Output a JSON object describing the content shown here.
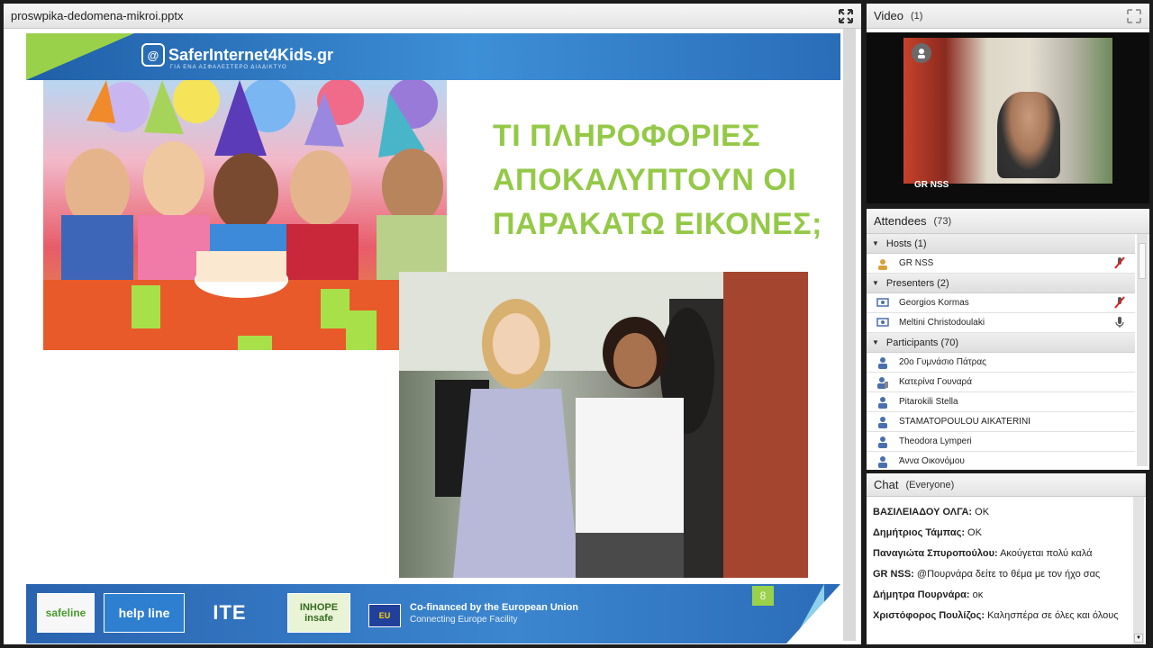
{
  "share": {
    "title": "proswpika-dedomena-mikroi.pptx",
    "slide": {
      "logo_text": "SaferInternet4Kids.gr",
      "logo_tagline": "ΓΙΑ ΕΝΑ ΑΣΦΑΛΕΣΤΕΡΟ ΔΙΑΔΙΚΤΥΟ",
      "title_lines": [
        "ΤΙ ΠΛΗΡΟΦΟΡΙΕΣ",
        "ΑΠΟΚΑΛΥΠΤΟΥΝ ΟΙ",
        "ΠΑΡΑΚΑΤΩ ΕΙΚΟΝΕΣ;"
      ],
      "slide_number": "8",
      "partners": {
        "safeline": "safeline",
        "helpline": "help line",
        "ite": "ITE",
        "inhope": "INHOPE insafe",
        "eu": "EU"
      },
      "cofinanced_line1": "Co-financed by the European Union",
      "cofinanced_line2": "Connecting Europe Facility"
    }
  },
  "video": {
    "title": "Video",
    "count": "(1)",
    "presenter_label": "GR NSS"
  },
  "attendees": {
    "title": "Attendees",
    "count": "(73)",
    "groups": [
      {
        "label": "Hosts (1)",
        "people": [
          {
            "name": "GR NSS",
            "role": "host",
            "mic": "muted"
          }
        ]
      },
      {
        "label": "Presenters (2)",
        "people": [
          {
            "name": "Georgios Kormas",
            "role": "presenter",
            "mic": "muted"
          },
          {
            "name": "Meltini Christodoulaki",
            "role": "presenter",
            "mic": "on"
          }
        ]
      },
      {
        "label": "Participants (70)",
        "people": [
          {
            "name": "20ο Γυμνάσιο Πάτρας",
            "role": "participant",
            "mic": ""
          },
          {
            "name": "Κατερίνα Γουναρά",
            "role": "participant-phone",
            "mic": ""
          },
          {
            "name": "Pitarokili Stella",
            "role": "participant",
            "mic": ""
          },
          {
            "name": "STAMATOPOULOU AIKATERINI",
            "role": "participant",
            "mic": ""
          },
          {
            "name": "Theodora Lymperi",
            "role": "participant",
            "mic": ""
          },
          {
            "name": "Άννα Οικονόμου",
            "role": "participant",
            "mic": ""
          }
        ]
      }
    ]
  },
  "chat": {
    "title": "Chat",
    "scope": "(Everyone)",
    "messages": [
      {
        "sender": "ΒΑΣΙΛΕΙΑΔΟΥ ΟΛΓΑ:",
        "text": " OK"
      },
      {
        "sender": "Δημήτριος Τάμπας:",
        "text": " OK"
      },
      {
        "sender": "Παναγιώτα Σπυροπούλου:",
        "text": " Ακούγεται πολύ καλά"
      },
      {
        "sender": "GR NSS:",
        "text": " @Πουρνάρα δείτε το θέμα με τον ήχο σας"
      },
      {
        "sender": "Δήμητρα Πουρνάρα:",
        "text": " οκ"
      },
      {
        "sender": "Χριστόφορος Πουλίζος:",
        "text": " Καλησπέρα σε όλες και όλους"
      }
    ]
  },
  "colors": {
    "title_green": "#94c947",
    "slide_blue": "#2a63b0",
    "accent_green": "#9ad14a"
  },
  "icons": {
    "fullscreen": "fullscreen-icon",
    "host": "host-icon",
    "presenter": "presenter-icon",
    "participant": "participant-icon",
    "mic_muted": "mic-muted-icon",
    "mic_on": "mic-on-icon",
    "collapse": "collapse-triangle-icon"
  }
}
